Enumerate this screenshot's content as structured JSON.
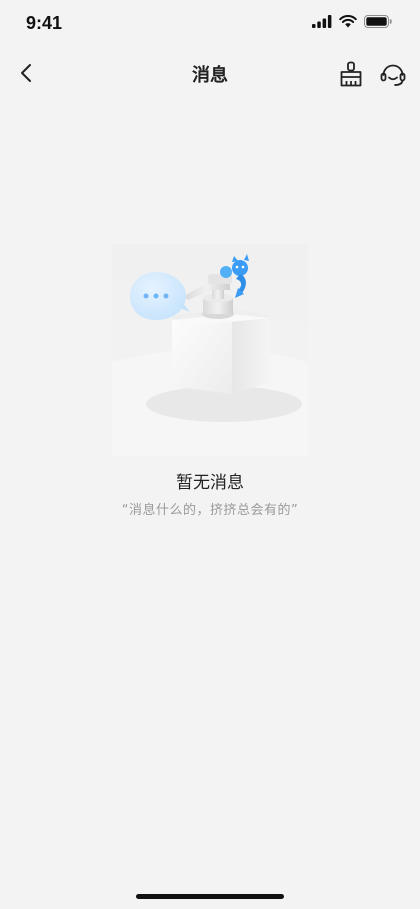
{
  "status_bar": {
    "time": "9:41"
  },
  "nav": {
    "title": "消息",
    "back_icon": "chevron-left-icon",
    "clean_icon": "broom-icon",
    "service_icon": "headset-icon"
  },
  "empty_state": {
    "title": "暂无消息",
    "subtitle": "“消息什么的，挤挤总会有的”",
    "illustration": "soap-dispenser-with-chat-bubble",
    "accent_color": "#3b9cf5"
  },
  "colors": {
    "background": "#f3f3f3",
    "text_primary": "#222222",
    "text_secondary": "#9a9a9a"
  }
}
